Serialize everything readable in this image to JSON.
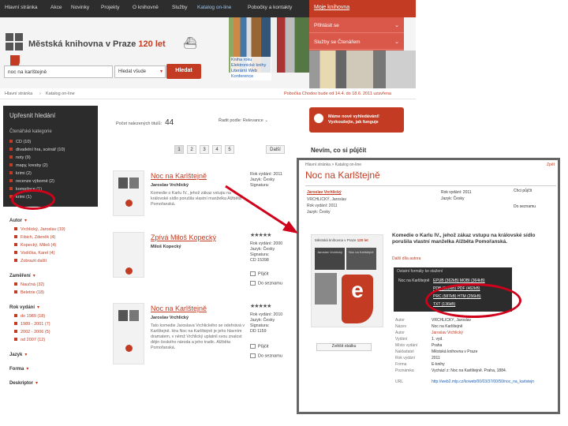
{
  "nav": {
    "items": [
      "Hlavní stránka",
      "Akce",
      "Novinky",
      "Projekty",
      "O knihovně",
      "Služby",
      "Katalog on-line",
      "Pobočky a kontakty"
    ],
    "my_library": "Moje knihovna",
    "dropdown": [
      "Přihlásit se",
      "Služby se Čtenářem"
    ]
  },
  "header": {
    "logo_name": "Městská knihovna v Praze",
    "logo_years": "120 let",
    "promo_links": [
      "Kniha roku",
      "Elektronické knihy",
      "Literární Web",
      "Konference"
    ]
  },
  "search": {
    "query": "noc na karlštejně",
    "scope": "Hledat všude",
    "button": "Hledat"
  },
  "breadcrumb": {
    "home": "Hlavní stránka",
    "current": "Katalog on-line",
    "notice": "Pobočka Chodov bude od 14.4. do 18.6. 2011 uzavřena"
  },
  "sidebar": {
    "title": "Upřesnit hledání",
    "section": "Čtenářské kategorie",
    "categories": [
      "CD (10)",
      "divadelní hra, scénář (10)",
      "noty (9)",
      "mapy, kresby (2)",
      "krimi (2)",
      "recenze výborné (2)",
      "kompilace (1)",
      "krimi (1)"
    ],
    "facets": [
      {
        "label": "Autor",
        "items": [
          "Vrchlický, Jaroslav (19)",
          "Fibich, Zdeněk (4)",
          "Kopecký, Miloš (4)",
          "Vodička, Karel (4)",
          "Zobrazit další"
        ]
      },
      {
        "label": "Zaměření",
        "items": [
          "Naučná (32)",
          "Beletrie (18)"
        ]
      },
      {
        "label": "Rok vydání",
        "items": [
          "do 1989 (18)",
          "1989 - 2001 (7)",
          "2002 - 2006 (5)",
          "od 2007 (12)"
        ]
      },
      {
        "label": "Jazyk",
        "items": []
      },
      {
        "label": "Forma",
        "items": []
      },
      {
        "label": "Deskriptor",
        "items": []
      }
    ]
  },
  "results": {
    "count_label": "Počet nalezených titulů:",
    "count": "44",
    "sort_label": "Řadit podle: Relevance",
    "pages": [
      "1",
      "2",
      "3",
      "4",
      "5"
    ],
    "next": "Další",
    "records": [
      {
        "title": "Noc na Karlštejně",
        "author": "Jaroslav Vrchlický",
        "desc": "Komedie o Karlu IV., jehož zákaz vstupu na královské sídlo porušila vlastní manželka Alžběta Pomořanská.",
        "meta": [
          "Rok vydání: 2011",
          "Jazyk: Česky",
          "Signatura:"
        ],
        "actions": []
      },
      {
        "title": "Zpívá Miloš Kopecký",
        "author": "Miloš Kopecký",
        "desc": "",
        "stars": "★★★★★",
        "meta": [
          "Rok vydání: 2000",
          "Jazyk: Česky",
          "Signatura:",
          "CD 15398"
        ],
        "actions": [
          "Půjčit",
          "Do seznamu"
        ]
      },
      {
        "title": "Noc na Karlštejně",
        "author": "Jaroslav Vrchlický",
        "desc": "Tato komedie Jaroslava Vrchlického se odehrává v Karlštejně. Hra Noc na Karlštejně je jeho hlavním dramatem, v němž Vrchlický uplatnil svou znalost dějin českého národa a jeho tradic. Alžběta Pomořanská.",
        "stars": "★★★★★",
        "meta": [
          "Rok vydání: 2010",
          "Jazyk: Česky",
          "Signatura:",
          "DD 1159"
        ],
        "actions": [
          "Půjčit",
          "Do seznamu"
        ]
      }
    ]
  },
  "right": {
    "new_button": "Máme nové vyhledávání! Vyzkoušejte, jak funguje",
    "ask": "Nevím, co si půjčit"
  },
  "detail": {
    "crumb": "Hlavní stránka > Katalog on-line",
    "back": "Zpět",
    "title": "Noc na Karlštejně",
    "author_line": "Jaroslav Vrchlický",
    "lines": [
      "VRCHLICKÝ, Jaroslav",
      "Rok vydání: 2011",
      "Jazyk: Česky"
    ],
    "meta_right": [
      "Rok vydání: 2011",
      "Jazyk: Česky"
    ],
    "actions": [
      "Chci půjčit",
      "Do seznamu"
    ],
    "cover_header": "Městská knihovna v Praze",
    "cover_years": "120 let",
    "cover_name": "Jaroslav Vrchlický",
    "cover_title": "Noc na Karlštejně",
    "summary": "Komedie o Karlu IV., jehož zákaz vstupu na královské sídlo porušila vlastní manželka Alžběta Pomořanská.",
    "other": "Další díla autora",
    "formats_head": "Ostatní formáty ke stažení",
    "formats": [
      {
        "label": "Noc na Karlštejně",
        "links": "EPUB (362kB) MOBI (364kB)"
      },
      {
        "label": "",
        "links": "PDB (512kB) PDF (462kB)"
      },
      {
        "label": "",
        "links": "PRC (587kB) HTM (256kB)"
      },
      {
        "label": "",
        "links": "TXT (136kB)"
      }
    ],
    "zoom": "Zvětšit obálku",
    "fields": [
      {
        "k": "Autor",
        "v": "VRCHLICKÝ, Jaroslav"
      },
      {
        "k": "Název",
        "v": "Noc na Karlštejně"
      },
      {
        "k": "Autor",
        "v": "Jaroslav Vrchlický"
      },
      {
        "k": "Vydání",
        "v": "1. vyd."
      },
      {
        "k": "Místo vydání",
        "v": "Praha"
      },
      {
        "k": "Nakladatel",
        "v": "Městská knihovna v Praze"
      },
      {
        "k": "Rok vydání",
        "v": "2011"
      },
      {
        "k": "Forma",
        "v": "E-knihy"
      },
      {
        "k": "Poznámka",
        "v": "Vychází z: Noc na Karlštejně. Praha, 1884."
      },
      {
        "k": "URL",
        "v": "http://web2.mlp.cz/koweb/00/03/37/00/50/noc_na_karlstejne.pdf"
      }
    ]
  }
}
